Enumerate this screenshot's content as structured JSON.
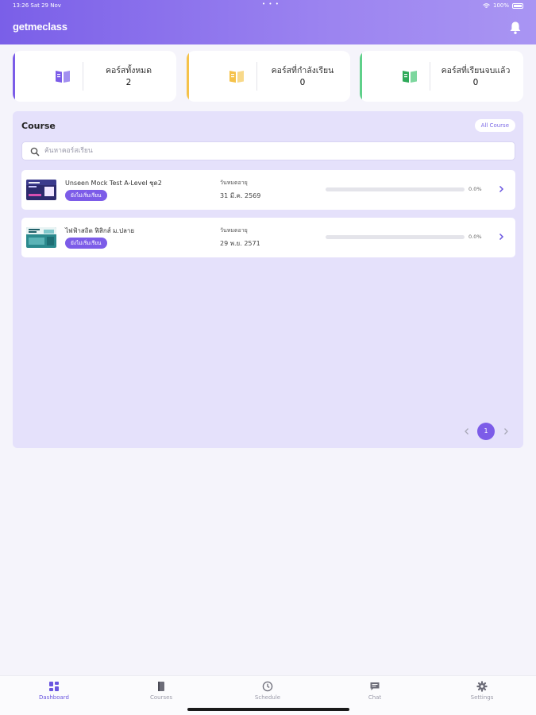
{
  "status_bar": {
    "time": "13:26  Sat 29 Nov",
    "dots": "• • •",
    "battery": "100%"
  },
  "app": {
    "logo": "getmeclass"
  },
  "stats": [
    {
      "label": "คอร์สทั้งหมด",
      "value": "2",
      "color": "#7b5ce8",
      "icon": "book-icon"
    },
    {
      "label": "คอร์สที่กำลังเรียน",
      "value": "0",
      "color": "#f5c24a",
      "icon": "book-icon"
    },
    {
      "label": "คอร์สที่เรียนจบแล้ว",
      "value": "0",
      "color": "#5fd08a",
      "icon": "book-icon"
    }
  ],
  "course_panel": {
    "title": "Course",
    "all_button": "All Course",
    "search_placeholder": "ค้นหาคอร์สเรียน"
  },
  "courses": [
    {
      "title": "Unseen Mock Test A-Level ชุด2",
      "badge": "ยังไม่เริ่มเรียน",
      "expire_label": "วันหมดอายุ",
      "expire_date": "31 มี.ค. 2569",
      "progress": 0.0,
      "progress_text": "0.0%"
    },
    {
      "title": "ไฟฟ้าสถิต ฟิสิกส์ ม.ปลาย",
      "badge": "ยังไม่เริ่มเรียน",
      "expire_label": "วันหมดอายุ",
      "expire_date": "29 พ.ย. 2571",
      "progress": 0.0,
      "progress_text": "0.0%"
    }
  ],
  "pagination": {
    "current": "1"
  },
  "tabs": [
    {
      "label": "Dashboard",
      "active": true
    },
    {
      "label": "Courses",
      "active": false
    },
    {
      "label": "Schedule",
      "active": false
    },
    {
      "label": "Chat",
      "active": false
    },
    {
      "label": "Settings",
      "active": false
    }
  ],
  "colors": {
    "accent": "#7c5ce8",
    "panel_bg": "#e5e1fb",
    "header_start": "#7a5fe8",
    "header_end": "#a995f3"
  }
}
